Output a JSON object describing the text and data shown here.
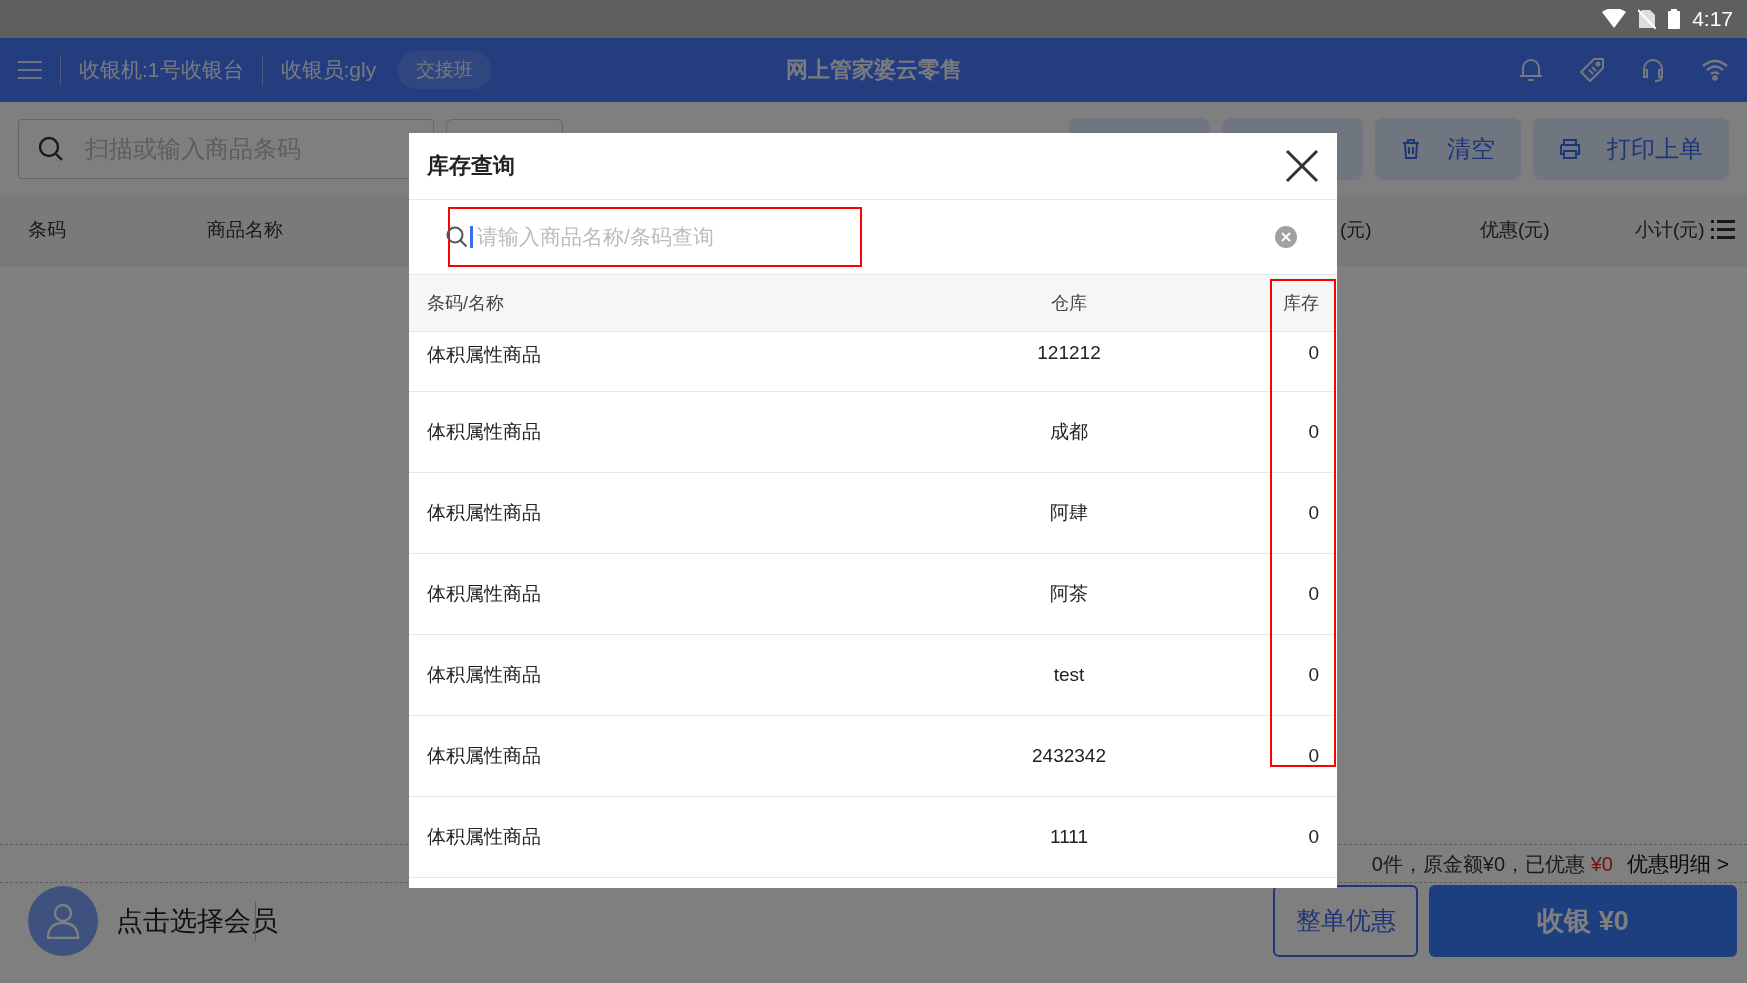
{
  "status_bar": {
    "time": "4:17"
  },
  "top_bar": {
    "register": "收银机:1号收银台",
    "cashier": "收银员:gly",
    "shift_button": "交接班",
    "title": "网上管家婆云零售"
  },
  "toolbar": {
    "search": {
      "placeholder": "扫描或输入商品条码"
    },
    "buttons": [
      {
        "label": "清空",
        "kind": "clear"
      },
      {
        "label": "打印上单",
        "kind": "print"
      }
    ]
  },
  "cart_columns": [
    "条码",
    "商品名称",
    "(元)",
    "优惠(元)",
    "小计(元)"
  ],
  "summary": {
    "text": "0件，原金额¥0，已优惠",
    "discount": "¥0",
    "detail_link": "优惠明细 >"
  },
  "member": {
    "label": "点击选择会员"
  },
  "footer_buttons": {
    "discount": "整单优惠",
    "checkout": "收银 ¥0"
  },
  "dialog": {
    "title": "库存查询",
    "search": {
      "placeholder": "请输入商品名称/条码查询",
      "focused": true,
      "highlighted": true
    },
    "columns": [
      {
        "label": "条码/名称",
        "highlighted": false
      },
      {
        "label": "仓库",
        "highlighted": false
      },
      {
        "label": "库存",
        "highlighted": true
      }
    ],
    "rows": [
      {
        "name": "体积属性商品",
        "warehouse": "121212",
        "stock": "0"
      },
      {
        "name": "体积属性商品",
        "warehouse": "成都",
        "stock": "0"
      },
      {
        "name": "体积属性商品",
        "warehouse": "阿肆",
        "stock": "0"
      },
      {
        "name": "体积属性商品",
        "warehouse": "阿茶",
        "stock": "0"
      },
      {
        "name": "体积属性商品",
        "warehouse": "test",
        "stock": "0"
      },
      {
        "name": "体积属性商品",
        "warehouse": "2432342",
        "stock": "0"
      },
      {
        "name": "体积属性商品",
        "warehouse": "1111",
        "stock": "0"
      }
    ]
  }
}
